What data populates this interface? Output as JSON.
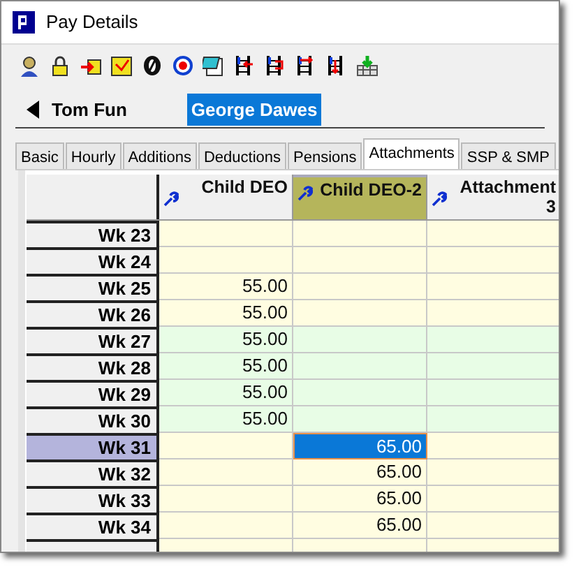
{
  "window": {
    "title": "Pay Details"
  },
  "toolbar": {
    "icons": [
      {
        "kind": "person"
      },
      {
        "kind": "lock"
      },
      {
        "kind": "import"
      },
      {
        "kind": "check"
      },
      {
        "kind": "zero"
      },
      {
        "kind": "target"
      },
      {
        "kind": "notebook"
      },
      {
        "kind": "ladder-back"
      },
      {
        "kind": "ladder-loop"
      },
      {
        "kind": "ladder-right"
      },
      {
        "kind": "ladder-down"
      },
      {
        "kind": "grid-down"
      }
    ]
  },
  "employees": [
    {
      "name": "Tom Fun",
      "selected": false
    },
    {
      "name": "George Dawes",
      "selected": true
    }
  ],
  "tabs": [
    {
      "label": "Basic",
      "selected": false
    },
    {
      "label": "Hourly",
      "selected": false
    },
    {
      "label": "Additions",
      "selected": false
    },
    {
      "label": "Deductions",
      "selected": false
    },
    {
      "label": "Pensions",
      "selected": false
    },
    {
      "label": "Attachments",
      "selected": true
    },
    {
      "label": "SSP & SMP",
      "selected": false
    }
  ],
  "table": {
    "columns": [
      {
        "label": "Child DEO",
        "selected": false
      },
      {
        "label": "Child DEO-2",
        "selected": true
      },
      {
        "label": "Attachment 3",
        "selected": false
      }
    ],
    "rows": [
      {
        "label": "Wk 23",
        "color": "#fffde1",
        "selected": false,
        "cells": [
          {
            "selected": false
          },
          {
            "selected": false
          },
          {
            "selected": false
          }
        ]
      },
      {
        "label": "Wk 24",
        "color": "#fffde1",
        "selected": false,
        "cells": [
          {
            "selected": false
          },
          {
            "selected": false
          },
          {
            "selected": false
          }
        ]
      },
      {
        "label": "Wk 25",
        "color": "#fffde1",
        "selected": false,
        "cells": [
          {
            "value": "55.00",
            "selected": false
          },
          {
            "selected": false
          },
          {
            "selected": false
          }
        ]
      },
      {
        "label": "Wk 26",
        "color": "#fffde1",
        "selected": false,
        "cells": [
          {
            "value": "55.00",
            "selected": false
          },
          {
            "selected": false
          },
          {
            "selected": false
          }
        ]
      },
      {
        "label": "Wk 27",
        "color": "#e8fde6",
        "selected": false,
        "cells": [
          {
            "value": "55.00",
            "selected": false
          },
          {
            "selected": false
          },
          {
            "selected": false
          }
        ]
      },
      {
        "label": "Wk 28",
        "color": "#e8fde6",
        "selected": false,
        "cells": [
          {
            "value": "55.00",
            "selected": false
          },
          {
            "selected": false
          },
          {
            "selected": false
          }
        ]
      },
      {
        "label": "Wk 29",
        "color": "#e8fde6",
        "selected": false,
        "cells": [
          {
            "value": "55.00",
            "selected": false
          },
          {
            "selected": false
          },
          {
            "selected": false
          }
        ]
      },
      {
        "label": "Wk 30",
        "color": "#e8fde6",
        "selected": false,
        "cells": [
          {
            "value": "55.00",
            "selected": false
          },
          {
            "selected": false
          },
          {
            "selected": false
          }
        ]
      },
      {
        "label": "Wk 31",
        "color": "#fffde1",
        "selected": true,
        "cells": [
          {
            "selected": false
          },
          {
            "value": "65.00",
            "selected": true
          },
          {
            "selected": false
          }
        ]
      },
      {
        "label": "Wk 32",
        "color": "#fffde1",
        "selected": false,
        "cells": [
          {
            "selected": false
          },
          {
            "value": "65.00",
            "selected": false
          },
          {
            "selected": false
          }
        ]
      },
      {
        "label": "Wk 33",
        "color": "#fffde1",
        "selected": false,
        "cells": [
          {
            "selected": false
          },
          {
            "value": "65.00",
            "selected": false
          },
          {
            "selected": false
          }
        ]
      },
      {
        "label": "Wk 34",
        "color": "#fffde1",
        "selected": false,
        "cells": [
          {
            "selected": false
          },
          {
            "value": "65.00",
            "selected": false
          },
          {
            "selected": false
          }
        ]
      }
    ]
  }
}
